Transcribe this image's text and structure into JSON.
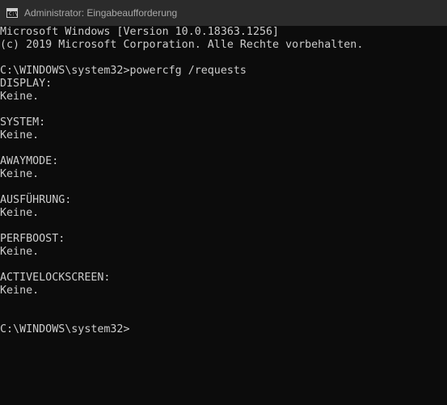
{
  "window": {
    "title": "Administrator: Eingabeaufforderung",
    "icon": "cmd-icon",
    "icon_prompt": "C:\\"
  },
  "console": {
    "lines": [
      "Microsoft Windows [Version 10.0.18363.1256]",
      "(c) 2019 Microsoft Corporation. Alle Rechte vorbehalten.",
      "",
      "C:\\WINDOWS\\system32>powercfg /requests",
      "DISPLAY:",
      "Keine.",
      "",
      "SYSTEM:",
      "Keine.",
      "",
      "AWAYMODE:",
      "Keine.",
      "",
      "AUSFÜHRUNG:",
      "Keine.",
      "",
      "PERFBOOST:",
      "Keine.",
      "",
      "ACTIVELOCKSCREEN:",
      "Keine.",
      "",
      "",
      "C:\\WINDOWS\\system32>"
    ]
  },
  "colors": {
    "background": "#0c0c0c",
    "titlebar": "#2b2b2b",
    "text": "#cccccc",
    "title_text": "#a8a8a8"
  }
}
